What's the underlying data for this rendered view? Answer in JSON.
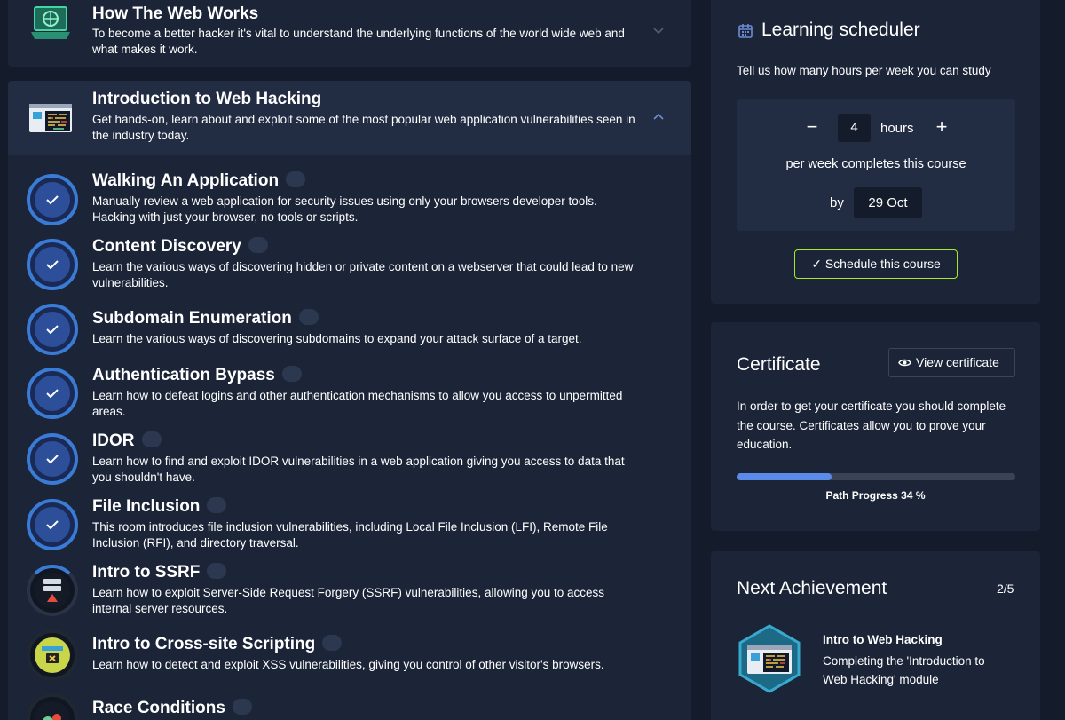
{
  "modules": [
    {
      "title": "How The Web Works",
      "description": "To become a better hacker it's vital to understand the underlying functions of the world wide web and what makes it work.",
      "expanded": false
    },
    {
      "title": "Introduction to Web Hacking",
      "description": "Get hands-on, learn about and exploit some of the most popular web application vulnerabilities seen in the industry today.",
      "expanded": true
    }
  ],
  "rooms": [
    {
      "title": "Walking An Application",
      "description": "Manually review a web application for security issues using only your browsers developer tools. Hacking with just your browser, no tools or scripts.",
      "completed": true
    },
    {
      "title": "Content Discovery",
      "description": "Learn the various ways of discovering hidden or private content on a webserver that could lead to new vulnerabilities.",
      "completed": true
    },
    {
      "title": "Subdomain Enumeration",
      "description": "Learn the various ways of discovering subdomains to expand your attack surface of a target.",
      "completed": true
    },
    {
      "title": "Authentication Bypass",
      "description": "Learn how to defeat logins and other authentication mechanisms to allow you access to unpermitted areas.",
      "completed": true
    },
    {
      "title": "IDOR",
      "description": "Learn how to find and exploit IDOR vulnerabilities in a web application giving you access to data that you shouldn't have.",
      "completed": true
    },
    {
      "title": "File Inclusion",
      "description": "This room introduces file inclusion vulnerabilities, including Local File Inclusion (LFI), Remote File Inclusion (RFI), and directory traversal.",
      "completed": true
    },
    {
      "title": "Intro to SSRF",
      "description": "Learn how to exploit Server-Side Request Forgery (SSRF) vulnerabilities, allowing you to access internal server resources.",
      "completed": false
    },
    {
      "title": "Intro to Cross-site Scripting",
      "description": "Learn how to detect and exploit XSS vulnerabilities, giving you control of other visitor's browsers.",
      "completed": false
    },
    {
      "title": "Race Conditions",
      "description": "",
      "completed": false
    }
  ],
  "scheduler": {
    "title": "Learning scheduler",
    "subtitle": "Tell us how many hours per week you can study",
    "minus": "−",
    "plus": "+",
    "hours": "4",
    "hours_label": "hours",
    "per_week": "per week completes this course",
    "by_label": "by",
    "date": "29 Oct",
    "button": "Schedule this course"
  },
  "certificate": {
    "title": "Certificate",
    "view_button": "View certificate",
    "description": "In order to get your certificate you should complete the course. Certificates allow you to prove your education.",
    "progress": 0.34,
    "progress_label": "Path Progress 34 %"
  },
  "achievement": {
    "title": "Next Achievement",
    "count": "2/5",
    "name": "Intro to Web Hacking",
    "description": "Completing the 'Introduction to Web Hacking' module"
  },
  "colors": {
    "accent_blue": "#3a7bd5",
    "progress": "#5b8ae8",
    "button_border": "#a3ea2a",
    "card": "#1c2538",
    "background": "#141b2b"
  }
}
